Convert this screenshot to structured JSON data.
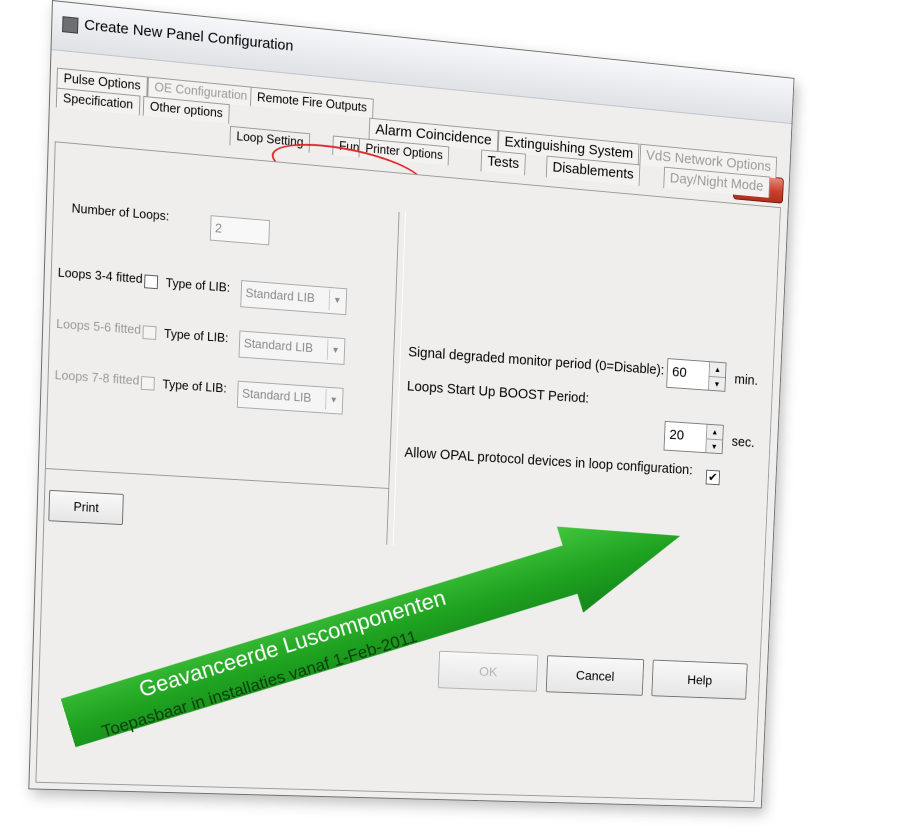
{
  "window": {
    "title": "Create New Panel Configuration",
    "close_label": "x"
  },
  "tabs": {
    "row1": [
      {
        "label": "Pulse Options",
        "enabled": true
      },
      {
        "label": "OE Configuration",
        "enabled": false
      },
      {
        "label": "Remote Fire Outputs",
        "enabled": true
      }
    ],
    "row2": [
      {
        "label": "Specification",
        "enabled": true
      },
      {
        "label": "Other options",
        "enabled": true
      },
      {
        "label": "Alarm Coincidence",
        "enabled": true
      },
      {
        "label": "Extinguishing System",
        "enabled": true
      },
      {
        "label": "VdS Network Options",
        "enabled": false
      }
    ],
    "row3": [
      {
        "label": "Loop Setting",
        "enabled": true,
        "selected": true
      },
      {
        "label": "Fun",
        "enabled": true
      },
      {
        "label": "Printer Options",
        "enabled": true
      },
      {
        "label": "Tests",
        "enabled": true
      },
      {
        "label": "Disablements",
        "enabled": true
      },
      {
        "label": "Day/Night Mode",
        "enabled": false
      }
    ]
  },
  "loop_settings": {
    "number_of_loops_label": "Number of Loops:",
    "number_of_loops_value": "2",
    "loop_rows": [
      {
        "label": "Loops 3-4 fitted",
        "enabled": true,
        "checked": false,
        "lib_label": "Type of LIB:",
        "lib_value": "Standard LIB"
      },
      {
        "label": "Loops 5-6 fitted",
        "enabled": false,
        "checked": false,
        "lib_label": "Type of LIB:",
        "lib_value": "Standard LIB"
      },
      {
        "label": "Loops 7-8 fitted",
        "enabled": false,
        "checked": false,
        "lib_label": "Type of LIB:",
        "lib_value": "Standard LIB"
      }
    ],
    "signal_degraded_label": "Signal degraded monitor period (0=Disable):",
    "signal_degraded_value": "60",
    "signal_degraded_unit": "min.",
    "boost_label": "Loops Start Up BOOST Period:",
    "boost_value": "20",
    "boost_unit": "sec.",
    "opal_label": "Allow OPAL protocol devices in loop configuration:",
    "opal_checked": true
  },
  "buttons": {
    "print": "Print",
    "ok": "OK",
    "cancel": "Cancel",
    "help": "Help"
  },
  "banner": {
    "line1": "Geavanceerde Luscomponenten",
    "line2": "Toepasbaar in installaties vanaf 1-Feb-2011"
  },
  "colors": {
    "banner_green": "#1fa220",
    "close_red": "#c9402c",
    "highlight_red": "#e0242a"
  }
}
